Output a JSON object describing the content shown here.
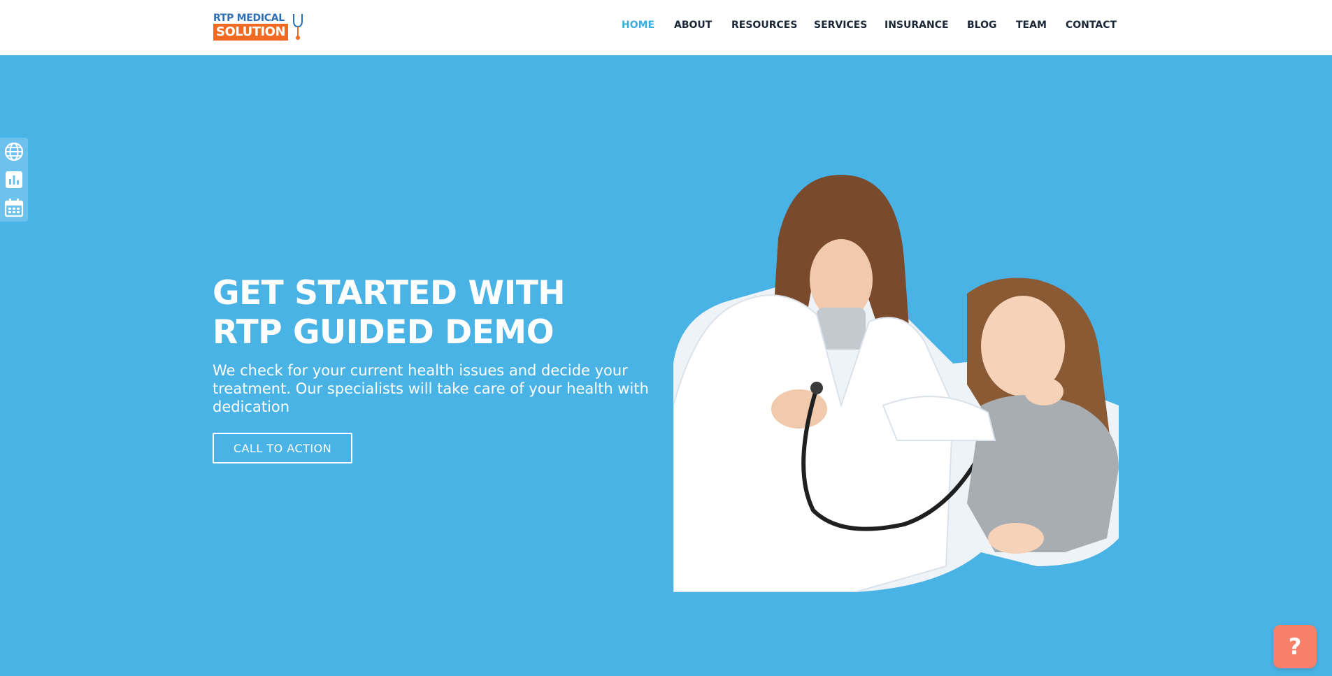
{
  "brand": {
    "logo_line1": "RTP MEDICAL",
    "logo_line2": "SOLUTION",
    "logo_alt": "RTP Medical Solution logo",
    "colors": {
      "blue": "#2d6fb7",
      "orange": "#f26a21"
    }
  },
  "nav": {
    "items": [
      {
        "label": "HOME",
        "active": true
      },
      {
        "label": "ABOUT",
        "active": false
      },
      {
        "label": "RESOURCES",
        "active": false
      },
      {
        "label": "SERVICES",
        "active": false
      },
      {
        "label": "INSURANCE",
        "active": false
      },
      {
        "label": "BLOG",
        "active": false
      },
      {
        "label": "TEAM",
        "active": false
      },
      {
        "label": "CONTACT",
        "active": false
      }
    ],
    "active_color": "#3aaee0",
    "text_color": "#1a2535"
  },
  "side_toolbar": {
    "items": [
      {
        "icon": "globe-icon"
      },
      {
        "icon": "bar-chart-icon"
      },
      {
        "icon": "calendar-icon"
      }
    ]
  },
  "hero": {
    "title_line1": "GET STARTED WITH",
    "title_line2": "RTP GUIDED DEMO",
    "text": "We check for your current health issues and decide your treatment. Our specialists will take care of your health with dedication",
    "cta_label": "CALL TO ACTION",
    "image_alt": "Doctor with a young girl using a stethoscope",
    "background_color": "#4ab3e5"
  },
  "help": {
    "label": "?",
    "icon": "help-icon",
    "color": "#f6806a"
  }
}
